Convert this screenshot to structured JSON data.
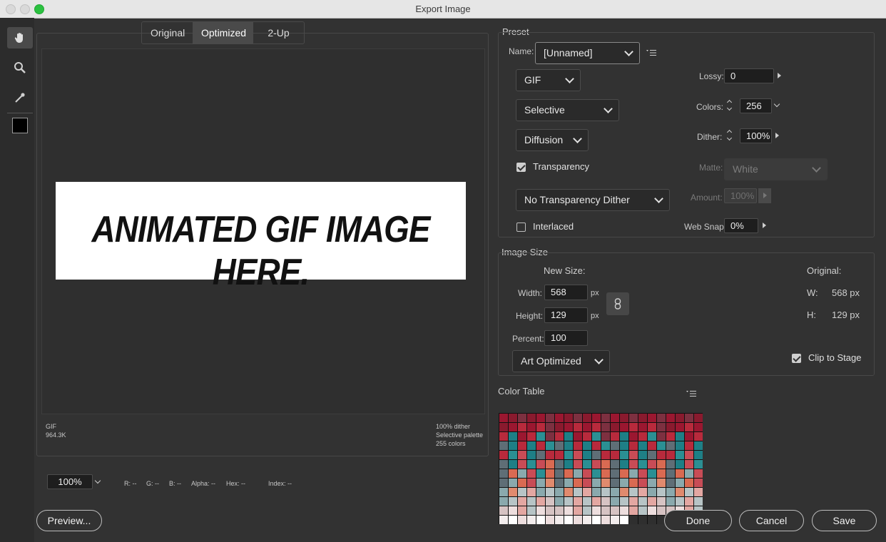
{
  "window": {
    "title": "Export Image"
  },
  "view_tabs": [
    {
      "label": "Original",
      "active": false
    },
    {
      "label": "Optimized",
      "active": true
    },
    {
      "label": "2-Up",
      "active": false
    }
  ],
  "preview_image": {
    "text": "ANIMATED GIF IMAGE HERE."
  },
  "image_info_left": {
    "format": "GIF",
    "size": "964.3K"
  },
  "image_info_right": {
    "dither": "100% dither",
    "palette": "Selective palette",
    "colors": "255 colors"
  },
  "zoom": {
    "value": "100%"
  },
  "readouts": {
    "r": "R: --",
    "g": "G: --",
    "b": "B: --",
    "alpha": "Alpha: --",
    "hex": "Hex: --",
    "index": "Index: --"
  },
  "preset": {
    "section_label": "Preset",
    "name_label": "Name:",
    "name_value": "[Unnamed]",
    "format": "GIF",
    "reduction": "Selective",
    "dither_algo": "Diffusion",
    "transparency_label": "Transparency",
    "transparency_checked": true,
    "transparency_dither": "No Transparency Dither",
    "interlaced_label": "Interlaced",
    "interlaced_checked": false,
    "lossy_label": "Lossy:",
    "lossy_value": "0",
    "colors_label": "Colors:",
    "colors_value": "256",
    "dither_label": "Dither:",
    "dither_value": "100%",
    "matte_label": "Matte:",
    "matte_value": "White",
    "amount_label": "Amount:",
    "amount_value": "100%",
    "websnap_label": "Web Snap:",
    "websnap_value": "0%"
  },
  "image_size": {
    "section_label": "Image Size",
    "new_size_label": "New Size:",
    "width_label": "Width:",
    "width_value": "568",
    "height_label": "Height:",
    "height_value": "129",
    "percent_label": "Percent:",
    "percent_value": "100",
    "unit": "px",
    "original_label": "Original:",
    "orig_w_label": "W:",
    "orig_w_value": "568 px",
    "orig_h_label": "H:",
    "orig_h_value": "129 px",
    "quality": "Art Optimized",
    "clip_label": "Clip to Stage",
    "clip_checked": true
  },
  "color_table": {
    "section_label": "Color Table"
  },
  "buttons": {
    "preview": "Preview...",
    "done": "Done",
    "cancel": "Cancel",
    "save": "Save"
  },
  "colors": {
    "palette": [
      "#9b1730",
      "#8a1a2e",
      "#b82a3c",
      "#1e7f86",
      "#2b8f93",
      "#5f6e76",
      "#c84c56",
      "#d96a52",
      "#e08a6e",
      "#8aa9ad",
      "#b7c4c6",
      "#e3a7a2",
      "#d6c3c3",
      "#eddede",
      "#f3eded",
      "#ffffff",
      "#7d3040"
    ]
  }
}
